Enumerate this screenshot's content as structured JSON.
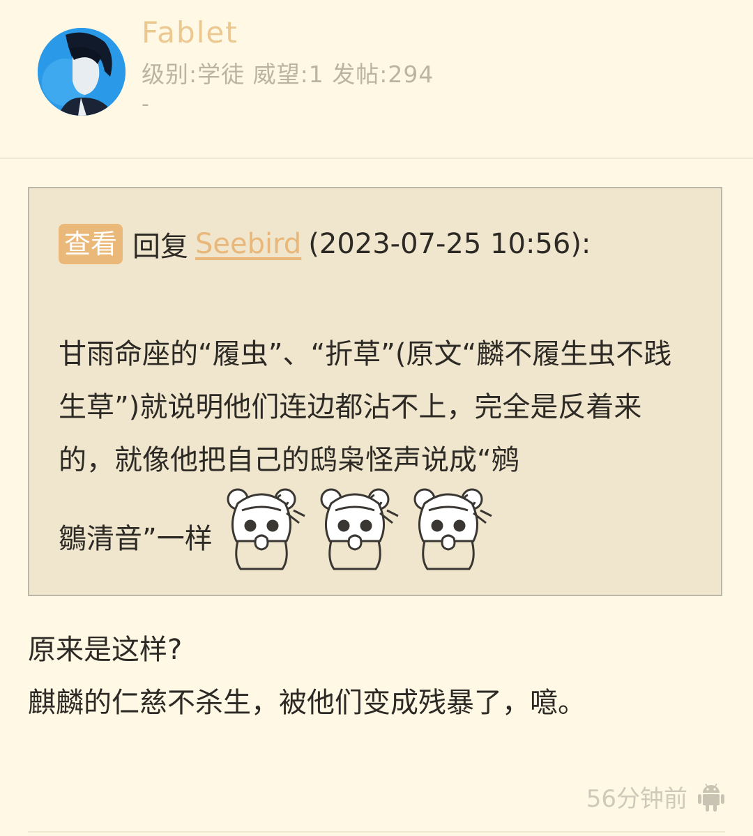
{
  "user": {
    "name": "Fablet",
    "info": "级别:学徒 威望:1 发帖:294",
    "signature": "-"
  },
  "quote": {
    "view_label": "查看",
    "reply_prefix": "回复",
    "reply_to": "Seebird",
    "reply_time": "(2023-07-25 10:56):",
    "text": "甘雨命座的“履虫”、“折草”(原文“麟不履生虫不践生草”)就说明他们连边都沾不上，完全是反着来的，就像他把自己的鸱枭怪声说成“鹓",
    "text_last": "鶵清音”一样"
  },
  "body": {
    "line1": "原来是这样?",
    "line2": "麒麟的仁慈不杀生，被他们变成残暴了，噫。"
  },
  "footer": {
    "time": "56分钟前"
  },
  "colors": {
    "background": "#fef8e4",
    "accent": "#eab878",
    "quote_bg": "#efe6cd"
  }
}
